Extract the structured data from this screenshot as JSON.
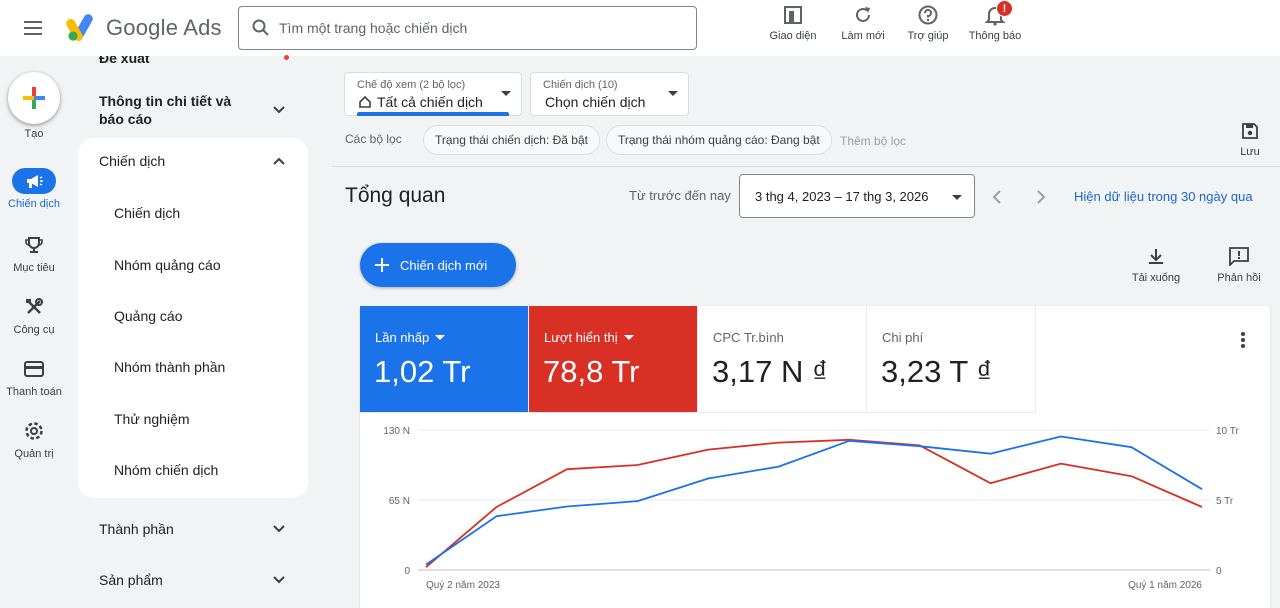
{
  "header": {
    "brand": "Google Ads",
    "search_placeholder": "Tìm một trang hoặc chiến dịch",
    "actions": [
      {
        "label": "Giao diện",
        "icon": "appearance-icon"
      },
      {
        "label": "Làm mới",
        "icon": "refresh-icon"
      },
      {
        "label": "Trợ giúp",
        "icon": "help-icon"
      },
      {
        "label": "Thông báo",
        "icon": "bell-icon",
        "badge": "!"
      }
    ]
  },
  "rail": {
    "create_label": "Tạo",
    "items": [
      {
        "label": "Chiến dịch",
        "icon": "megaphone-icon",
        "active": true
      },
      {
        "label": "Mục tiêu",
        "icon": "trophy-icon"
      },
      {
        "label": "Công cụ",
        "icon": "tools-icon"
      },
      {
        "label": "Thanh toán",
        "icon": "credit-card-icon"
      },
      {
        "label": "Quản trị",
        "icon": "gear-icon"
      }
    ]
  },
  "nav": {
    "cut_top": "Đề xuất",
    "insights": "Thông tin chi tiết và báo cáo",
    "campaigns_group": "Chiến dịch",
    "campaign_items": [
      "Chiến dịch",
      "Nhóm quảng cáo",
      "Quảng cáo",
      "Nhóm thành phần",
      "Thử nghiệm",
      "Nhóm chiến dịch"
    ],
    "assets": "Thành phần",
    "products": "Sản phẩm"
  },
  "toolbar": {
    "view_small": "Chế độ xem (2 bộ lọc)",
    "view_value": "Tất cả chiến dịch",
    "campaign_small": "Chiến dịch (10)",
    "campaign_value": "Chọn chiến dịch",
    "filters_label": "Các bộ lọc",
    "chips": [
      "Trạng thái chiến dịch: Đã bật",
      "Trạng thái nhóm quảng cáo: Đang bật"
    ],
    "add_filter": "Thêm bộ lọc",
    "save": "Lưu"
  },
  "overview": {
    "title": "Tổng quan",
    "range_label": "Từ trước đến nay",
    "range_value": "3 thg 4, 2023 – 17 thg 3, 2026",
    "last30": "Hiện dữ liệu trong 30 ngày qua",
    "new_campaign": "Chiến dịch mới",
    "download": "Tải xuống",
    "feedback": "Phản hồi"
  },
  "metrics": [
    {
      "name": "Lần nhấp",
      "value": "1,02 Tr",
      "color": "#1a73e8",
      "dropdown": true
    },
    {
      "name": "Lượt hiển thị",
      "value": "78,8 Tr",
      "color": "#d93025",
      "dropdown": true
    },
    {
      "name": "CPC Tr.bình",
      "value": "3,17 N ₫"
    },
    {
      "name": "Chi phí",
      "value": "3,23 T ₫"
    }
  ],
  "chart_data": {
    "type": "line",
    "x_labels": [
      "Quý 2 năm 2023",
      "Quý 1 năm 2026"
    ],
    "y_left": {
      "ticks": [
        "0",
        "65 N",
        "130 N"
      ],
      "range": [
        0,
        130
      ]
    },
    "y_right": {
      "ticks": [
        "0",
        "5 Tr",
        "10 Tr"
      ],
      "range": [
        0,
        10
      ]
    },
    "grid": true,
    "series": [
      {
        "name": "Lần nhấp",
        "axis": "left",
        "color": "#1a73e8",
        "values": [
          5,
          50,
          59,
          64,
          85,
          96,
          120,
          115,
          108,
          124,
          114,
          75
        ]
      },
      {
        "name": "Lượt hiển thị",
        "axis": "right",
        "color": "#d93025",
        "values": [
          0.2,
          4.5,
          7.2,
          7.5,
          8.6,
          9.1,
          9.3,
          8.9,
          6.2,
          7.6,
          6.7,
          4.5
        ]
      }
    ]
  }
}
